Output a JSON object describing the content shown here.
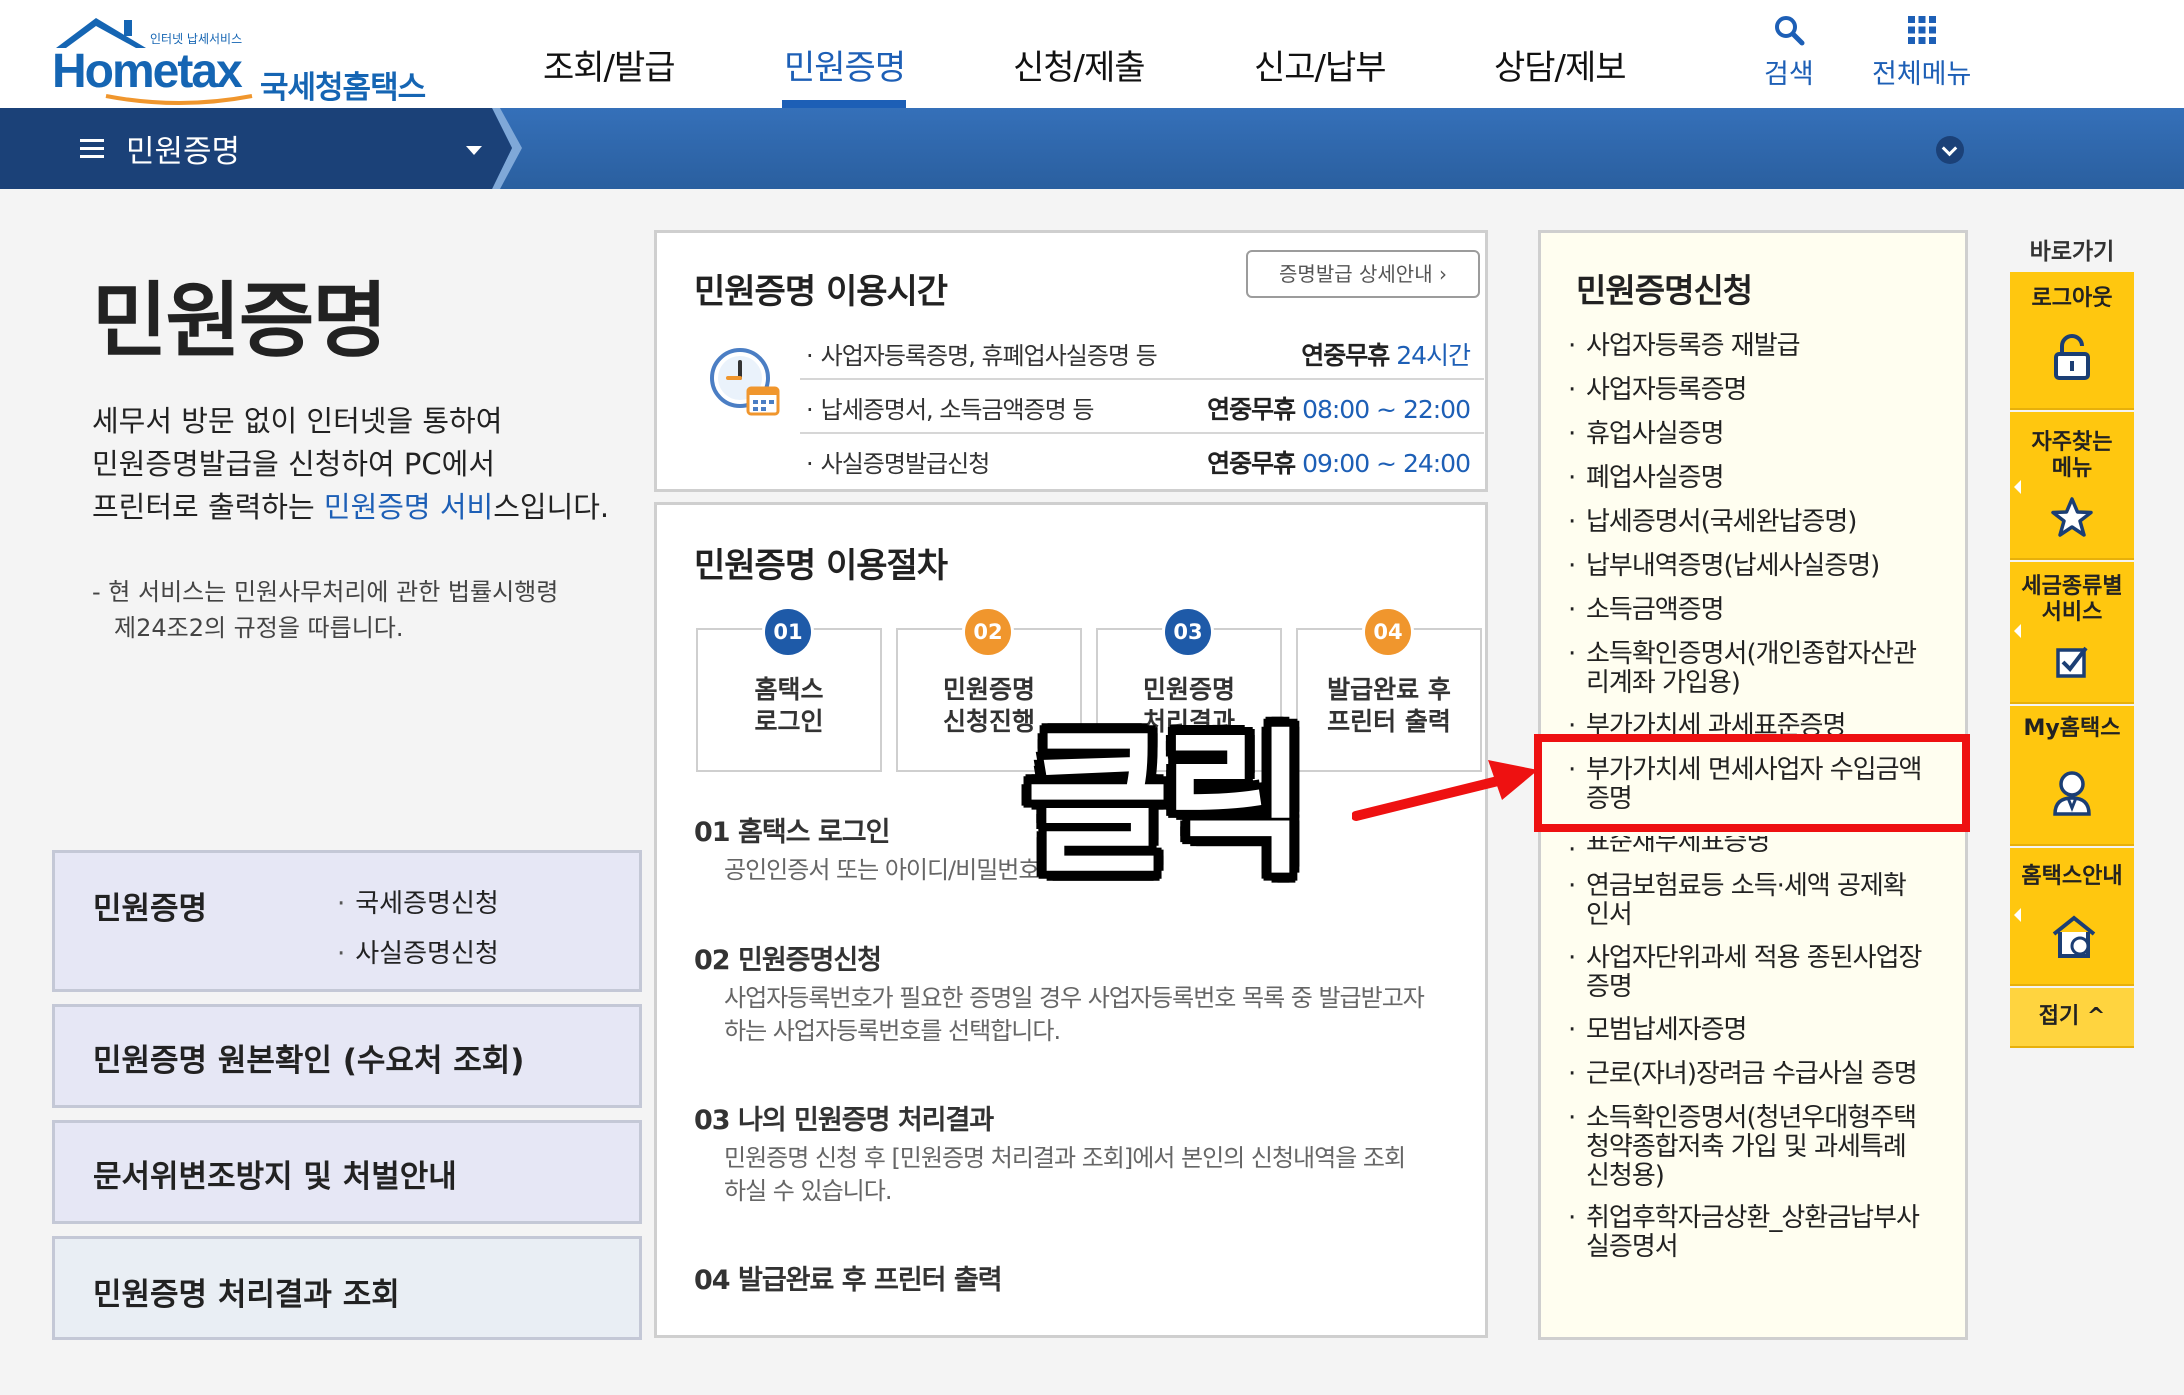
{
  "header": {
    "logo_text": "Hometax",
    "logo_tagline": "인터넷 납세서비스",
    "logo_org": "국세청홈택스",
    "nav": [
      "조회/발급",
      "민원증명",
      "신청/제출",
      "신고/납부",
      "상담/제보"
    ],
    "active_nav": "민원증명",
    "search_label": "검색",
    "all_menu_label": "전체메뉴",
    "brand_color": "#1d5fb6"
  },
  "subbar": {
    "title": "민원증명"
  },
  "left": {
    "page_title": "민원증명",
    "desc_line1": "세무서 방문 없이 인터넷을 통하여",
    "desc_line2": "민원증명발급을 신청하여 PC에서",
    "desc_line3_pre": "프린터로 출력하는 ",
    "desc_line3_highlight": "민원증명 서비",
    "desc_line3_post": "스입니다.",
    "note_line1": "- 현 서비스는 민원사무처리에 관한 법률시행령",
    "note_line2": "제24조2의 규정을 따릅니다.",
    "box1_title": "민원증명",
    "box1_links": [
      "국세증명신청",
      "사실증명신청"
    ],
    "box2_title": "민원증명 원본확인 (수요처 조회)",
    "box3_title": "문서위변조방지 및 처벌안내",
    "box4_title": "민원증명 처리결과 조회"
  },
  "hours": {
    "title": "민원증명 이용시간",
    "detail_button": "증명발급 상세안내",
    "rows": [
      {
        "label": "사업자등록증명, 휴폐업사실증명 등",
        "prefix": "연중무휴",
        "time": "24시간"
      },
      {
        "label": "납세증명서, 소득금액증명 등",
        "prefix": "연중무휴",
        "time": "08:00 ~ 22:00"
      },
      {
        "label": "사실증명발급신청",
        "prefix": "연중무휴",
        "time": "09:00 ~ 24:00"
      }
    ]
  },
  "procedure": {
    "title": "민원증명 이용절차",
    "steps": [
      {
        "num": "01",
        "line1": "홈택스",
        "line2": "로그인",
        "color": "#1e5aa8"
      },
      {
        "num": "02",
        "line1": "민원증명",
        "line2": "신청진행",
        "color": "#f0962d"
      },
      {
        "num": "03",
        "line1": "민원증명",
        "line2": "처리결과",
        "color": "#1e5aa8"
      },
      {
        "num": "04",
        "line1": "발급완료 후",
        "line2": "프린터 출력",
        "color": "#f0962d"
      }
    ],
    "detail1_title": "01 홈택스 로그인",
    "detail1_text": "공인인증서 또는 아이디/비밀번호",
    "detail2_title": "02 민원증명신청",
    "detail2_text1": "사업자등록번호가 필요한 증명일 경우 사업자등록번호 목록 중 발급받고자",
    "detail2_text2": "하는 사업자등록번호를 선택합니다.",
    "detail3_title": "03 나의 민원증명 처리결과",
    "detail3_text1": "민원증명 신청 후 [민원증명 처리결과 조회]에서 본인의 신청내역을 조회",
    "detail3_text2": "하실 수 있습니다.",
    "detail4_title": "04 발급완료 후 프린터 출력"
  },
  "apply": {
    "title": "민원증명신청",
    "items": [
      [
        "사업자등록증 재발급"
      ],
      [
        "사업자등록증명"
      ],
      [
        "휴업사실증명"
      ],
      [
        "폐업사실증명"
      ],
      [
        "납세증명서(국세완납증명)"
      ],
      [
        "납부내역증명(납세사실증명)"
      ],
      [
        "소득금액증명"
      ],
      [
        "소득확인증명서(개인종합자산관",
        "리계좌 가입용)"
      ],
      [
        "부가가치세 과세표준증명"
      ],
      [
        "부가가치세 면세사업자 수입금액",
        "증명"
      ],
      [
        "표준재무제표증명"
      ],
      [
        "연금보험료등 소득·세액 공제확",
        "인서"
      ],
      [
        "사업자단위과세 적용 종된사업장",
        "증명"
      ],
      [
        "모범납세자증명"
      ],
      [
        "근로(자녀)장려금 수급사실 증명"
      ],
      [
        "소득확인증명서(청년우대형주택",
        "청약종합저축 가입 및 과세특례",
        "신청용)"
      ],
      [
        "취업후학자금상환_상환금납부사",
        "실증명서"
      ]
    ]
  },
  "quick": {
    "title": "바로가기",
    "logout": "로그아웃",
    "favorites_1": "자주찾는",
    "favorites_2": "메뉴",
    "taxservice_1": "세금종류별",
    "taxservice_2": "서비스",
    "my_hometax": "My홈택스",
    "guide": "홈택스안내",
    "fold": "접기 ^",
    "accent": "#ffc70f"
  },
  "annotation": {
    "text": "클릭",
    "color": "#ee1111"
  }
}
